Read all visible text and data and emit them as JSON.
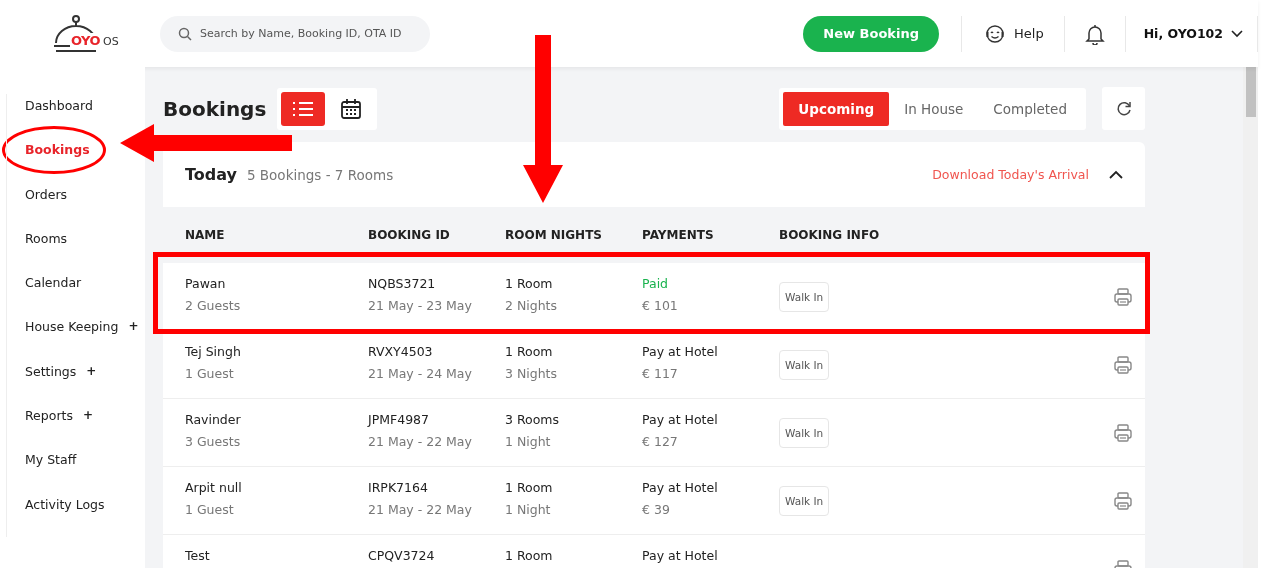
{
  "header": {
    "logo": {
      "brand": "OYO",
      "suffix": "OS"
    },
    "search": {
      "placeholder": "Search by Name, Booking ID, OTA ID"
    },
    "new_booking": "New Booking",
    "help": "Help",
    "user": "Hi, OYO102"
  },
  "sidebar": {
    "items": [
      {
        "label": "Dashboard",
        "selected": false,
        "circled": false
      },
      {
        "label": "Bookings",
        "selected": true,
        "circled": true
      },
      {
        "label": "Orders",
        "selected": false,
        "circled": false
      },
      {
        "label": "Rooms",
        "selected": false,
        "circled": false
      },
      {
        "label": "Calendar",
        "selected": false,
        "circled": false
      },
      {
        "label": "House Keeping",
        "selected": false,
        "expand_icon": "+",
        "circled": false
      },
      {
        "label": "Settings",
        "selected": false,
        "expand_icon": "+",
        "circled": false
      },
      {
        "label": "Reports",
        "selected": false,
        "expand_icon": "+",
        "circled": false
      },
      {
        "label": "My Staff",
        "selected": false,
        "circled": false
      },
      {
        "label": "Activity Logs",
        "selected": false,
        "circled": false
      }
    ]
  },
  "page": {
    "title": "Bookings",
    "views": [
      {
        "kind": "list",
        "selected": true
      },
      {
        "kind": "calendar",
        "selected": false
      }
    ],
    "tabs": [
      {
        "label": "Upcoming",
        "selected": true
      },
      {
        "label": "In House",
        "selected": false
      },
      {
        "label": "Completed",
        "selected": false
      }
    ]
  },
  "section": {
    "title": "Today",
    "summary": "5 Bookings - 7 Rooms",
    "download": "Download Today's Arrival",
    "expanded": true,
    "columns": [
      {
        "label": "NAME",
        "pointed": false
      },
      {
        "label": "BOOKING ID",
        "pointed": false
      },
      {
        "label": "ROOM NIGHTS",
        "pointed": true
      },
      {
        "label": "PAYMENTS",
        "pointed": false
      },
      {
        "label": "BOOKING INFO",
        "pointed": false
      }
    ],
    "rows": [
      {
        "name": "Pawan",
        "guests": "2 Guests",
        "id": "NQBS3721",
        "dates": "21 May - 23 May",
        "rooms": "1 Room",
        "nights": "2 Nights",
        "payment": "Paid",
        "paid": true,
        "amount": "€ 101",
        "info": "Walk In",
        "highlighted": true
      },
      {
        "name": "Tej Singh",
        "guests": "1 Guest",
        "id": "RVXY4503",
        "dates": "21 May - 24 May",
        "rooms": "1 Room",
        "nights": "3 Nights",
        "payment": "Pay at Hotel",
        "paid": false,
        "amount": "€ 117",
        "info": "Walk In",
        "highlighted": false
      },
      {
        "name": "Ravinder",
        "guests": "3 Guests",
        "id": "JPMF4987",
        "dates": "21 May - 22 May",
        "rooms": "3 Rooms",
        "nights": "1 Night",
        "payment": "Pay at Hotel",
        "paid": false,
        "amount": "€ 127",
        "info": "Walk In",
        "highlighted": false
      },
      {
        "name": "Arpit null",
        "guests": "1 Guest",
        "id": "IRPK7164",
        "dates": "21 May - 22 May",
        "rooms": "1 Room",
        "nights": "1 Night",
        "payment": "Pay at Hotel",
        "paid": false,
        "amount": "€ 39",
        "info": "Walk In",
        "highlighted": false
      },
      {
        "name": "Test",
        "id": "CPQV3724",
        "rooms": "1 Room",
        "payment": "Pay at Hotel",
        "paid": false,
        "highlighted": false
      }
    ]
  }
}
